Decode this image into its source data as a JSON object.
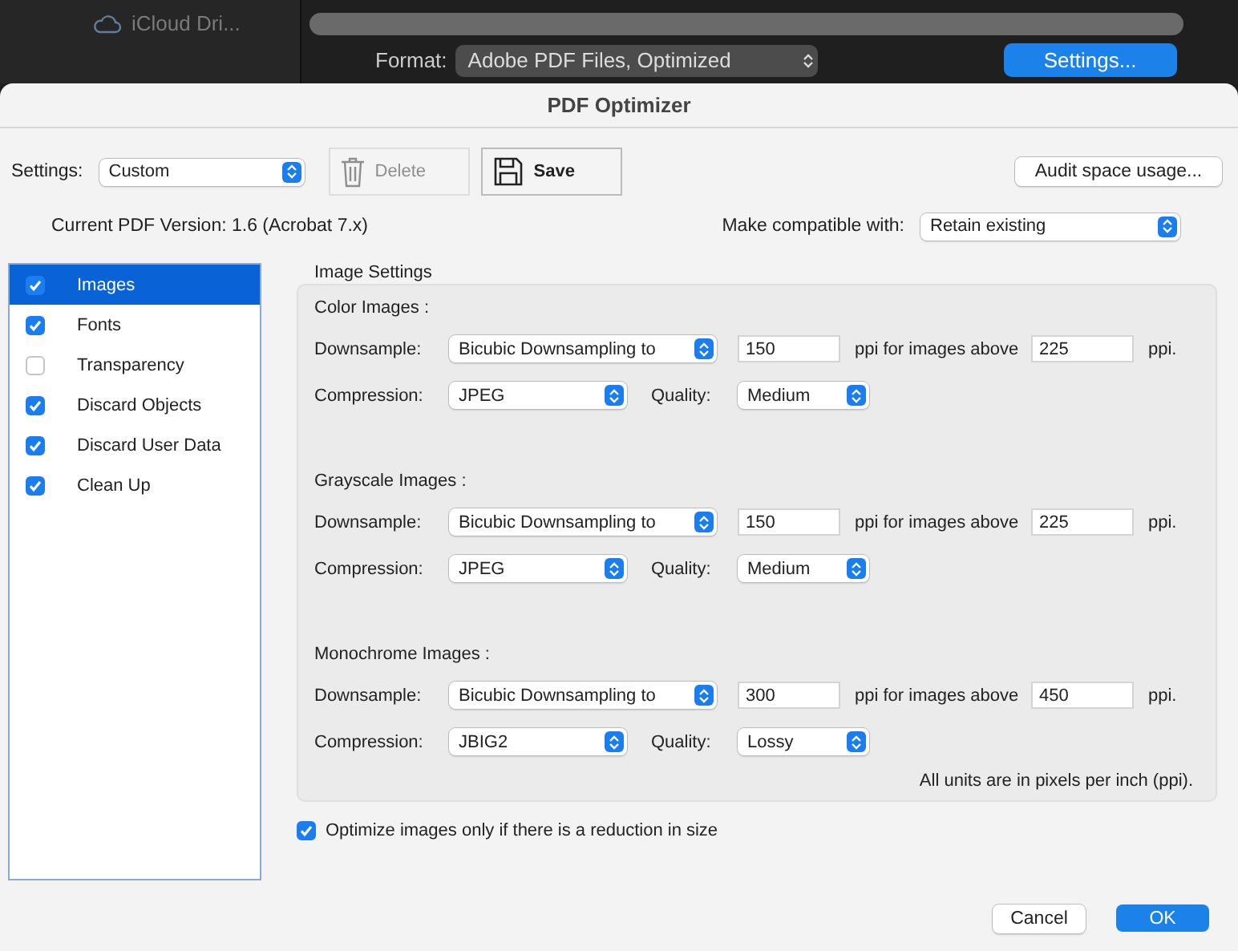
{
  "backdrop": {
    "sidebar_item": "iCloud Dri...",
    "format_label": "Format:",
    "format_value": "Adobe PDF Files, Optimized",
    "settings_button": "Settings..."
  },
  "dialog": {
    "title": "PDF Optimizer",
    "settings_label": "Settings:",
    "settings_value": "Custom",
    "delete_button": {
      "label": "Delete",
      "disabled": true
    },
    "save_button": {
      "label": "Save",
      "disabled": false
    },
    "audit_button": "Audit space usage...",
    "version": "Current PDF Version: 1.6 (Acrobat 7.x)",
    "compat_label": "Make compatible with:",
    "compat_value": "Retain existing",
    "categories": [
      {
        "label": "Images",
        "checked": true,
        "selected": true
      },
      {
        "label": "Fonts",
        "checked": true,
        "selected": false
      },
      {
        "label": "Transparency",
        "checked": false,
        "selected": false
      },
      {
        "label": "Discard Objects",
        "checked": true,
        "selected": false
      },
      {
        "label": "Discard User Data",
        "checked": true,
        "selected": false
      },
      {
        "label": "Clean Up",
        "checked": true,
        "selected": false
      }
    ],
    "panel_title": "Image Settings",
    "sections": [
      {
        "title": "Color Images :",
        "downsample_label": "Downsample:",
        "method": "Bicubic Downsampling to",
        "ppi": "150",
        "above_label": "ppi for images above",
        "above": "225",
        "unit": "ppi.",
        "compression_label": "Compression:",
        "compression": "JPEG",
        "quality_label": "Quality:",
        "quality": "Medium"
      },
      {
        "title": "Grayscale Images :",
        "downsample_label": "Downsample:",
        "method": "Bicubic Downsampling to",
        "ppi": "150",
        "above_label": "ppi for images above",
        "above": "225",
        "unit": "ppi.",
        "compression_label": "Compression:",
        "compression": "JPEG",
        "quality_label": "Quality:",
        "quality": "Medium"
      },
      {
        "title": "Monochrome Images :",
        "downsample_label": "Downsample:",
        "method": "Bicubic Downsampling to",
        "ppi": "300",
        "above_label": "ppi for images above",
        "above": "450",
        "unit": "ppi.",
        "compression_label": "Compression:",
        "compression": "JBIG2",
        "quality_label": "Quality:",
        "quality": "Lossy"
      }
    ],
    "units_note": "All units are in pixels per inch (ppi).",
    "optimize_only": {
      "label": "Optimize images only if there is a reduction in size",
      "checked": true
    },
    "cancel_button": "Cancel",
    "ok_button": "OK"
  }
}
